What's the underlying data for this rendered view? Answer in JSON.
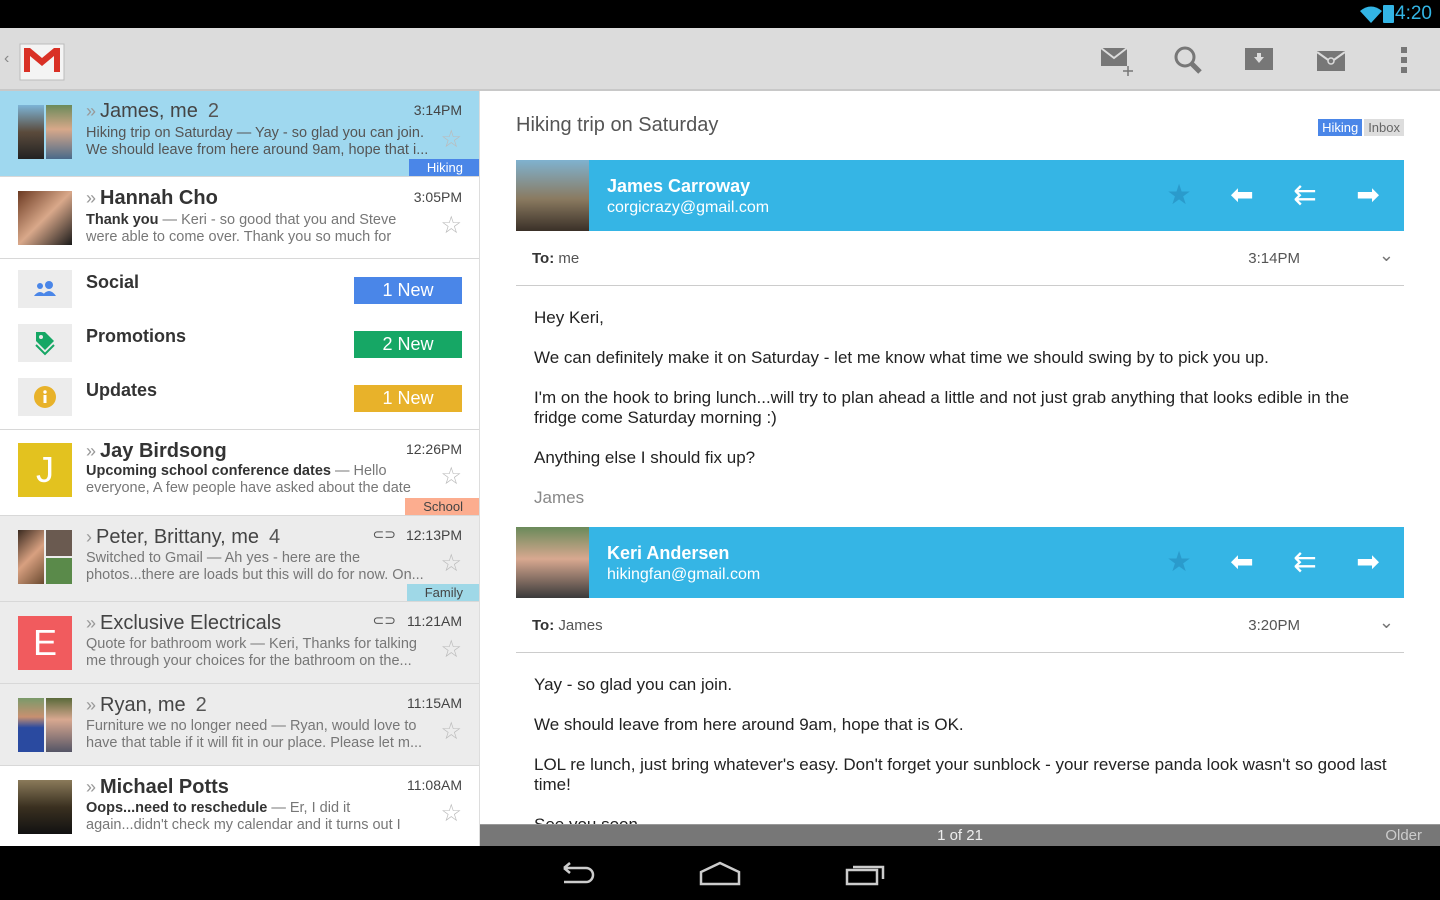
{
  "status_bar": {
    "time": "4:20",
    "icons": [
      "wifi-icon",
      "battery-icon"
    ]
  },
  "action_bar": {
    "app": "Gmail",
    "actions": [
      "compose-icon",
      "search-icon",
      "archive-icon",
      "mark-unread-icon",
      "overflow-menu-icon"
    ]
  },
  "conversations_top": [
    {
      "sender": "James, me",
      "count": "2",
      "time": "3:14PM",
      "subject": "Hiking trip on Saturday",
      "snippet": "Yay - so glad you can join. We should leave from here around 9am, hope that i...",
      "label": "Hiking",
      "label_color": "#4a86e8",
      "selected": true,
      "unread": false
    },
    {
      "sender": "Hannah Cho",
      "count": "",
      "time": "3:05PM",
      "subject": "Thank you",
      "snippet": "Keri - so good that you and Steve were able to come over. Thank you so much for making...",
      "unread": true
    }
  ],
  "categories": [
    {
      "label": "Social",
      "badge": "1 New",
      "color": "#4a86e8",
      "icon": "social-people-icon"
    },
    {
      "label": "Promotions",
      "badge": "2 New",
      "color": "#16a765",
      "icon": "promotions-tag-icon"
    },
    {
      "label": "Updates",
      "badge": "1 New",
      "color": "#e8b22a",
      "icon": "updates-info-icon"
    }
  ],
  "conversations": [
    {
      "sender": "Jay Birdsong",
      "count": "",
      "time": "12:26PM",
      "subject": "Upcoming school conference dates",
      "snippet": "Hello everyone, A few people have asked about the date f...",
      "label": "School",
      "label_color": "#fcad8f",
      "unread": true,
      "avatar_letter": "J",
      "avatar_color": "#e3c21f"
    },
    {
      "sender": "Peter, Brittany, me",
      "count": "4",
      "time": "12:13PM",
      "subject": "Switched to Gmail",
      "snippet": "Ah yes - here are the photos...there are loads but this will do for now. On...",
      "label": "Family",
      "label_color": "#9fd8e7",
      "attachment": true,
      "unread": false
    },
    {
      "sender": "Exclusive Electricals",
      "count": "",
      "time": "11:21AM",
      "subject": "Quote for bathroom work",
      "snippet": "Keri, Thanks for talking me through your choices for the bathroom on the...",
      "attachment": true,
      "unread": false,
      "avatar_letter": "E",
      "avatar_color": "#f15b5e"
    },
    {
      "sender": "Ryan, me",
      "count": "2",
      "time": "11:15AM",
      "subject": "Furniture we no longer need",
      "snippet": "Ryan, would love to have that table if it will fit in our place. Please let m...",
      "unread": false
    },
    {
      "sender": "Michael Potts",
      "count": "",
      "time": "11:08AM",
      "subject": "Oops...need to reschedule",
      "snippet": "Er, I did it again...didn't check my calendar and it turns out I can't make it...",
      "unread": true
    }
  ],
  "conversation": {
    "subject": "Hiking trip on Saturday",
    "labels": [
      "Hiking",
      "Inbox"
    ],
    "messages": [
      {
        "name": "James Carroway",
        "email": "corgicrazy@gmail.com",
        "to_label": "To:",
        "to": "me",
        "time": "3:14PM",
        "body": [
          "Hey Keri,",
          "We can definitely make it on Saturday - let me know what time we should swing by to pick you up.",
          "I'm on the hook to bring lunch...will try to plan ahead a little and not just grab anything that looks edible in the fridge come Saturday morning :)",
          "Anything else I should fix up?"
        ],
        "signature": "James"
      },
      {
        "name": "Keri Andersen",
        "email": "hikingfan@gmail.com",
        "to_label": "To:",
        "to": "James",
        "time": "3:20PM",
        "body": [
          "Yay - so glad you can join.",
          "We should leave from here around 9am, hope that is OK.",
          "LOL re lunch, just bring whatever's easy. Don't forget your sunblock - your reverse panda look wasn't so good last time!",
          "See you soon"
        ]
      }
    ]
  },
  "pager": {
    "position": "1 of 21",
    "older": "Older"
  },
  "nav_bar": [
    "back-icon",
    "home-icon",
    "recent-apps-icon"
  ],
  "colors": {
    "accent": "#35b5e5",
    "selected_row": "#9fd8ef"
  }
}
